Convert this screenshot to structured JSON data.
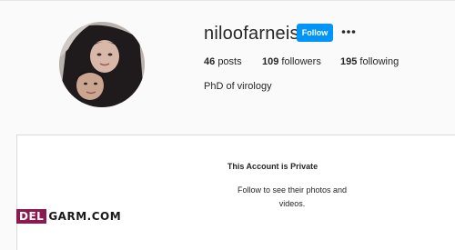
{
  "profile": {
    "username": "niloofarneisi",
    "bio": "PhD of virology",
    "avatar_description_icon": "profile-photo"
  },
  "actions": {
    "follow_label": "Follow",
    "more_icon": "ellipsis-icon"
  },
  "stats": {
    "posts_count": "46",
    "posts_label": "posts",
    "followers_count": "109",
    "followers_label": "followers",
    "following_count": "195",
    "following_label": "following"
  },
  "private_notice": {
    "title": "This Account is Private",
    "subtitle": "Follow to see their photos and videos."
  },
  "watermark": {
    "part1": "DEL",
    "part2": "GARM.COM"
  },
  "colors": {
    "accent": "#0095f6",
    "watermark": "#8a1a4f",
    "background": "#fafafa"
  }
}
